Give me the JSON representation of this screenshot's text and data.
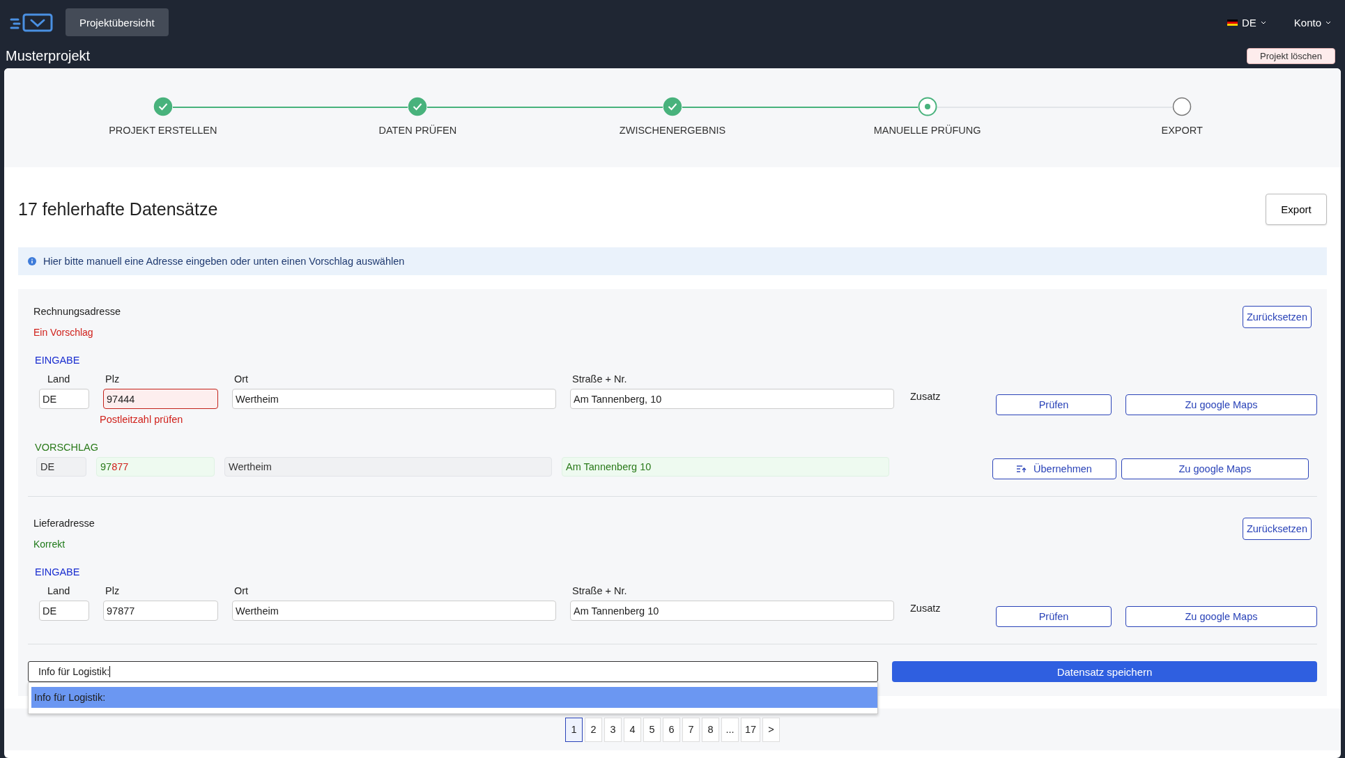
{
  "nav": {
    "home_button": "Projektübersicht",
    "language": "DE",
    "account": "Konto"
  },
  "project": {
    "title": "Musterprojekt",
    "delete_button": "Projekt löschen"
  },
  "steps": [
    {
      "label": "PROJEKT ERSTELLEN",
      "done": true,
      "current": false
    },
    {
      "label": "DATEN PRÜFEN",
      "done": true,
      "current": false
    },
    {
      "label": "ZWISCHENERGEBNIS",
      "done": true,
      "current": false
    },
    {
      "label": "MANUELLE PRÜFUNG",
      "done": false,
      "current": true
    },
    {
      "label": "EXPORT",
      "done": false,
      "current": false
    }
  ],
  "heading": "17 fehlerhafte Datensätze",
  "export_button": "Export",
  "info": "Hier bitte manuell eine Adresse eingeben oder unten einen Vorschlag auswählen",
  "addresses": [
    {
      "title": "Rechnungsadresse",
      "status": "Ein Vorschlag",
      "valid": false,
      "reset_button": "Zurücksetzen",
      "input_heading": "EINGABE",
      "labels": {
        "land": "Land",
        "plz": "Plz",
        "ort": "Ort",
        "strasse": "Straße + Nr.",
        "zusatz": "Zusatz"
      },
      "input": {
        "land": "DE",
        "plz": "97444",
        "ort": "Wertheim",
        "strasse": "Am Tannenberg, 10"
      },
      "plz_error": "Postleitzahl prüfen",
      "check_button": "Prüfen",
      "maps_button": "Zu google Maps",
      "suggestion": {
        "heading": "VORSCHLAG",
        "land": "DE",
        "plz_parts": [
          {
            "text": "97",
            "match": true
          },
          {
            "text": "877",
            "match": false
          }
        ],
        "ort": "Wertheim",
        "strasse": "Am Tannenberg 10",
        "strasse_match": true,
        "apply_button": "Übernehmen",
        "maps_button": "Zu google Maps"
      }
    },
    {
      "title": "Lieferadresse",
      "status": "Korrekt",
      "valid": true,
      "reset_button": "Zurücksetzen",
      "input_heading": "EINGABE",
      "labels": {
        "land": "Land",
        "plz": "Plz",
        "ort": "Ort",
        "strasse": "Straße + Nr.",
        "zusatz": "Zusatz"
      },
      "input": {
        "land": "DE",
        "plz": "97877",
        "ort": "Wertheim",
        "strasse": "Am Tannenberg 10"
      },
      "check_button": "Prüfen",
      "maps_button": "Zu google Maps"
    }
  ],
  "logistics": {
    "value": "Info für Logistik:",
    "options": [
      {
        "label": "Info für Logistik:",
        "selected": true
      }
    ]
  },
  "save_button": "Datensatz speichern",
  "pagination": [
    {
      "label": "1",
      "selected": true
    },
    {
      "label": "2",
      "selected": false
    },
    {
      "label": "3",
      "selected": false
    },
    {
      "label": "4",
      "selected": false
    },
    {
      "label": "5",
      "selected": false
    },
    {
      "label": "6",
      "selected": false
    },
    {
      "label": "7",
      "selected": false
    },
    {
      "label": "8",
      "selected": false
    },
    {
      "label": "...",
      "selected": false
    },
    {
      "label": "17",
      "selected": false
    },
    {
      "label": ">",
      "selected": false
    }
  ]
}
